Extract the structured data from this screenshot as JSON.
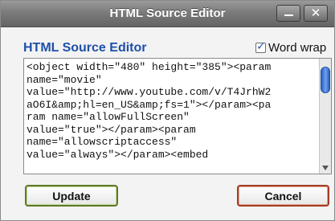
{
  "window": {
    "title": "HTML Source Editor",
    "minimize_glyph": "",
    "close_glyph": "✕"
  },
  "editor": {
    "heading": "HTML Source Editor",
    "word_wrap_label": "Word wrap",
    "word_wrap_checked": true,
    "source_lines": [
      "<object width=\"480\" height=\"385\"><param",
      "name=\"movie\"",
      "value=\"http://www.youtube.com/v/T4JrhW2",
      "aO6I&amp;hl=en_US&amp;fs=1\"></param><pa",
      "ram name=\"allowFullScreen\"",
      "value=\"true\"></param><param",
      "name=\"allowscriptaccess\"",
      "value=\"always\"></param><embed"
    ]
  },
  "buttons": {
    "update": "Update",
    "cancel": "Cancel"
  },
  "colors": {
    "heading": "#1e50a8",
    "titlebar": "#7b7b7b",
    "update_border": "#5e7a2a",
    "cancel_border": "#a23d26",
    "scroll_thumb": "#2b63c9"
  },
  "icons": [
    "minimize-icon",
    "close-icon",
    "checkmark-icon",
    "scroll-down-arrow-icon"
  ]
}
